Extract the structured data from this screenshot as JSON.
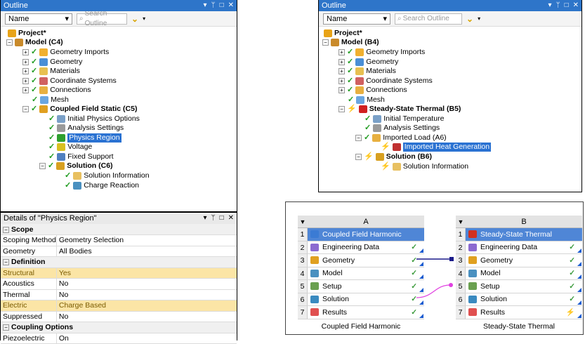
{
  "outline_left": {
    "title": "Outline",
    "sort": "Name",
    "search_placeholder": "Search Outline",
    "items": [
      "Project*",
      "Model (C4)",
      "Geometry Imports",
      "Geometry",
      "Materials",
      "Coordinate Systems",
      "Connections",
      "Mesh",
      "Coupled Field Static (C5)",
      "Initial Physics Options",
      "Analysis Settings",
      "Physics Region",
      "Voltage",
      "Fixed Support",
      "Solution (C6)",
      "Solution Information",
      "Charge Reaction"
    ]
  },
  "outline_right": {
    "title": "Outline",
    "sort": "Name",
    "search_placeholder": "Search Outline",
    "items": [
      "Project*",
      "Model (B4)",
      "Geometry Imports",
      "Geometry",
      "Materials",
      "Coordinate Systems",
      "Connections",
      "Mesh",
      "Steady-State Thermal (B5)",
      "Initial Temperature",
      "Analysis Settings",
      "Imported Load (A6)",
      "Imported Heat Generation",
      "Solution (B6)",
      "Solution Information"
    ]
  },
  "details": {
    "title": "Details of \"Physics Region\"",
    "rows": [
      {
        "section": "Scope"
      },
      {
        "k": "Scoping Method",
        "v": "Geometry Selection"
      },
      {
        "k": "Geometry",
        "v": "All Bodies"
      },
      {
        "section": "Definition"
      },
      {
        "k": "Structural",
        "v": "Yes",
        "hl": true
      },
      {
        "k": "Acoustics",
        "v": "No"
      },
      {
        "k": "Thermal",
        "v": "No"
      },
      {
        "k": "Electric",
        "v": "Charge Based",
        "hl": true
      },
      {
        "k": "Suppressed",
        "v": "No"
      },
      {
        "section": "Coupling Options"
      },
      {
        "k": "Piezoelectric",
        "v": "On"
      }
    ]
  },
  "schematic": {
    "A": {
      "col": "A",
      "name": "Coupled Field Harmonic",
      "rows": [
        "Coupled Field Harmonic",
        "Engineering Data",
        "Geometry",
        "Model",
        "Setup",
        "Solution",
        "Results"
      ]
    },
    "B": {
      "col": "B",
      "name": "Steady-State Thermal",
      "rows": [
        "Steady-State Thermal",
        "Engineering Data",
        "Geometry",
        "Model",
        "Setup",
        "Solution",
        "Results"
      ]
    },
    "status_check": "✓",
    "status_refresh": "⚡"
  },
  "icons": {
    "pin": "ᛘ",
    "close": "✕",
    "restore": "□",
    "dropdown": "▾"
  }
}
